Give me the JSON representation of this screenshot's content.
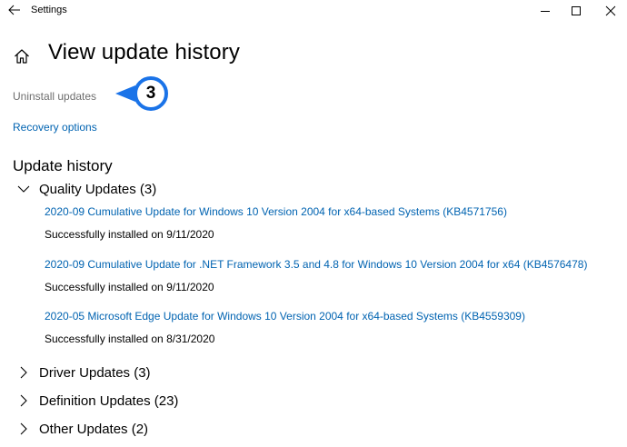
{
  "titlebar": {
    "title": "Settings",
    "back_icon": "back-arrow-icon",
    "minimize_icon": "minimize-icon",
    "maximize_icon": "maximize-icon",
    "close_icon": "close-icon"
  },
  "header": {
    "home_icon": "home-icon",
    "title": "View update history"
  },
  "links": {
    "uninstall": "Uninstall updates",
    "recovery": "Recovery options"
  },
  "step_badge": "3",
  "history": {
    "heading": "Update history",
    "groups": [
      {
        "label": "Quality Updates (3)",
        "expanded": true,
        "items": [
          {
            "title": "2020-09 Cumulative Update for Windows 10 Version 2004 for x64-based Systems (KB4571756)",
            "status": "Successfully installed on 9/11/2020"
          },
          {
            "title": "2020-09 Cumulative Update for .NET Framework 3.5 and 4.8 for Windows 10 Version 2004 for x64 (KB4576478)",
            "status": "Successfully installed on 9/11/2020"
          },
          {
            "title": "2020-05 Microsoft Edge Update for Windows 10 Version 2004 for x64-based Systems (KB4559309)",
            "status": "Successfully installed on 8/31/2020"
          }
        ]
      },
      {
        "label": "Driver Updates (3)",
        "expanded": false
      },
      {
        "label": "Definition Updates (23)",
        "expanded": false
      },
      {
        "label": "Other Updates (2)",
        "expanded": false
      }
    ]
  },
  "colors": {
    "link": "#0063b1",
    "muted_link": "#6e6e6e",
    "badge_accent": "#1a73e8"
  }
}
